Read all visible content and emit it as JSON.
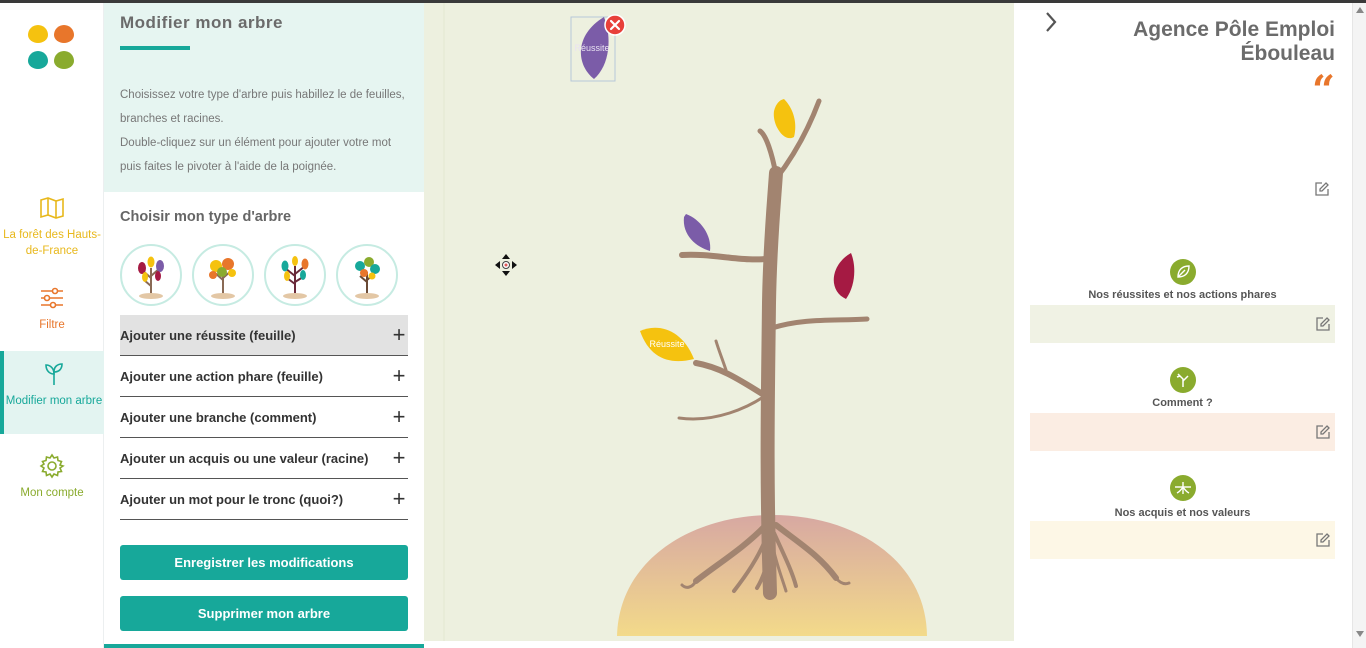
{
  "nav": {
    "items": [
      {
        "label": "La forêt des Hauts-de-France",
        "icon": "map-icon",
        "color": "#e8b81c"
      },
      {
        "label": "Filtre",
        "icon": "sliders-icon",
        "color": "#e8762b"
      },
      {
        "label": "Modifier mon arbre",
        "icon": "sprout-icon",
        "color": "#17a89a"
      },
      {
        "label": "Mon compte",
        "icon": "gear-icon",
        "color": "#8aab2e"
      }
    ]
  },
  "panel": {
    "title": "Modifier mon arbre",
    "desc_line1": "Choisissez votre type d'arbre puis habillez le de feuilles, branches et racines.",
    "desc_line2": "Double-cliquez sur un élément pour ajouter votre mot puis faites le pivoter à l'aide de la poignée.",
    "type_title": "Choisir mon type d'arbre",
    "actions": [
      "Ajouter une réussite (feuille)",
      "Ajouter une action phare (feuille)",
      "Ajouter une branche (comment)",
      "Ajouter un acquis ou une valeur (racine)",
      "Ajouter un mot pour le tronc (quoi?)"
    ],
    "save_label": "Enregistrer les modifications",
    "delete_label": "Supprimer mon arbre"
  },
  "canvas": {
    "selected_leaf_label": "Réussite",
    "leaf_label": "Réussite"
  },
  "right": {
    "agency_line1": "Agence Pôle Emploi",
    "agency_line2": "Ébouleau",
    "quote_mark": "“",
    "sections": [
      {
        "label": "Nos réussites et nos actions phares",
        "icon": "leaf-icon",
        "box_color": "#f0f2e4"
      },
      {
        "label": "Comment ?",
        "icon": "branch-icon",
        "box_color": "#fbede3"
      },
      {
        "label": "Nos acquis et nos valeurs",
        "icon": "roots-icon",
        "box_color": "#fdf7e6"
      }
    ]
  },
  "colors": {
    "accent": "#17a89a",
    "yellow": "#f5c20f",
    "purple": "#7b5ca8",
    "crimson": "#a51a43",
    "trunk": "#a28470"
  }
}
